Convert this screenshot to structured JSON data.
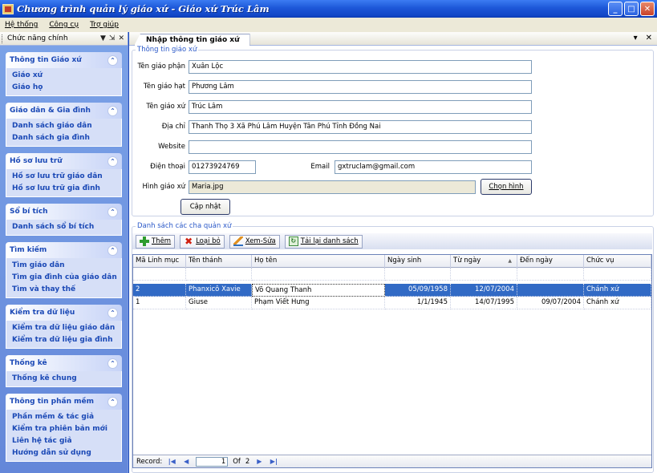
{
  "window": {
    "title": "Chương trình quản lý giáo xứ - Giáo xứ Trúc Lâm",
    "min": "_",
    "max": "□",
    "close": "✕"
  },
  "menubar": [
    "Hệ thống",
    "Công cụ",
    "Trợ giúp"
  ],
  "leftpanel": {
    "title": "Chức năng chính",
    "controls": [
      "▼",
      "⇲",
      "✕"
    ],
    "groups": [
      {
        "title": "Thông tin Giáo xứ",
        "items": [
          "Giáo xứ",
          "Giáo họ"
        ]
      },
      {
        "title": "Giáo dân & Gia đình",
        "items": [
          "Danh sách giáo dân",
          "Danh sách gia đình"
        ]
      },
      {
        "title": "Hồ sơ lưu trữ",
        "items": [
          "Hồ sơ lưu trữ giáo dân",
          "Hồ sơ lưu trữ gia đình"
        ]
      },
      {
        "title": "Sổ bí tích",
        "items": [
          "Danh sách sổ bí tích"
        ]
      },
      {
        "title": "Tìm kiếm",
        "items": [
          "Tìm giáo dân",
          "Tìm gia đình của giáo dân",
          "Tìm và thay thế"
        ]
      },
      {
        "title": "Kiểm tra dữ liệu",
        "items": [
          "Kiểm tra dữ liệu giáo dân",
          "Kiểm tra dữ liệu gia đình"
        ]
      },
      {
        "title": "Thống kê",
        "items": [
          "Thống kê chung"
        ]
      },
      {
        "title": "Thông tin phần mềm",
        "items": [
          "Phần mềm & tác giả",
          "Kiểm tra phiên bản mới",
          "Liên hệ tác giả",
          "Hướng dẫn sử dụng"
        ]
      }
    ]
  },
  "tab": {
    "title": "Nhập thông tin giáo xứ",
    "controls": [
      "▾",
      "✕"
    ]
  },
  "form": {
    "legend": "Thông tin giáo xứ",
    "giao_phan_label": "Tên giáo phận",
    "giao_phan_value": "Xuân Lộc",
    "giao_hat_label": "Tên giáo hạt",
    "giao_hat_value": "Phương Lâm",
    "giao_xu_label": "Tên giáo xứ",
    "giao_xu_value": "Trúc Lâm",
    "dia_chi_label": "Địa chỉ",
    "dia_chi_value": "Thanh Thọ 3   Xã Phú Lâm Huyện Tân Phú Tỉnh Đồng Nai",
    "website_label": "Website",
    "website_value": "",
    "dien_thoai_label": "Điện thoại",
    "dien_thoai_value": "01273924769",
    "email_label": "Email",
    "email_value": "gxtruclam@gmail.com",
    "hinh_label": "Hình giáo xứ",
    "hinh_value": "Maria.jpg",
    "chon_hinh": "Chọn hình",
    "cap_nhat": "Cập nhật"
  },
  "list": {
    "legend": "Danh sách các cha quản xứ",
    "toolbar": {
      "add": "Thêm",
      "remove": "Loại bỏ",
      "edit": "Xem-Sửa",
      "reload": "Tải lại danh sách"
    },
    "columns": [
      "Mã Linh mục",
      "Tên thánh",
      "Họ tên",
      "Ngày sinh",
      "Từ ngày",
      "Đến ngày",
      "Chức vụ"
    ],
    "rows": [
      {
        "ma": "2",
        "ten_thanh": "Phanxicô Xavie",
        "ho_ten": "Võ Quang Thanh",
        "ngay_sinh": "05/09/1958",
        "tu_ngay": "12/07/2004",
        "den_ngay": "",
        "chuc_vu": "Chánh xứ",
        "selected": true
      },
      {
        "ma": "1",
        "ten_thanh": "Giuse",
        "ho_ten": "Phạm Viết Hưng",
        "ngay_sinh": "1/1/1945",
        "tu_ngay": "14/07/1995",
        "den_ngay": "09/07/2004",
        "chuc_vu": "Chánh xứ",
        "selected": false
      }
    ],
    "sort_indicator": "▲",
    "nav": {
      "record_label": "Record:",
      "current": "1",
      "of_label": "Of",
      "total": "2"
    }
  }
}
